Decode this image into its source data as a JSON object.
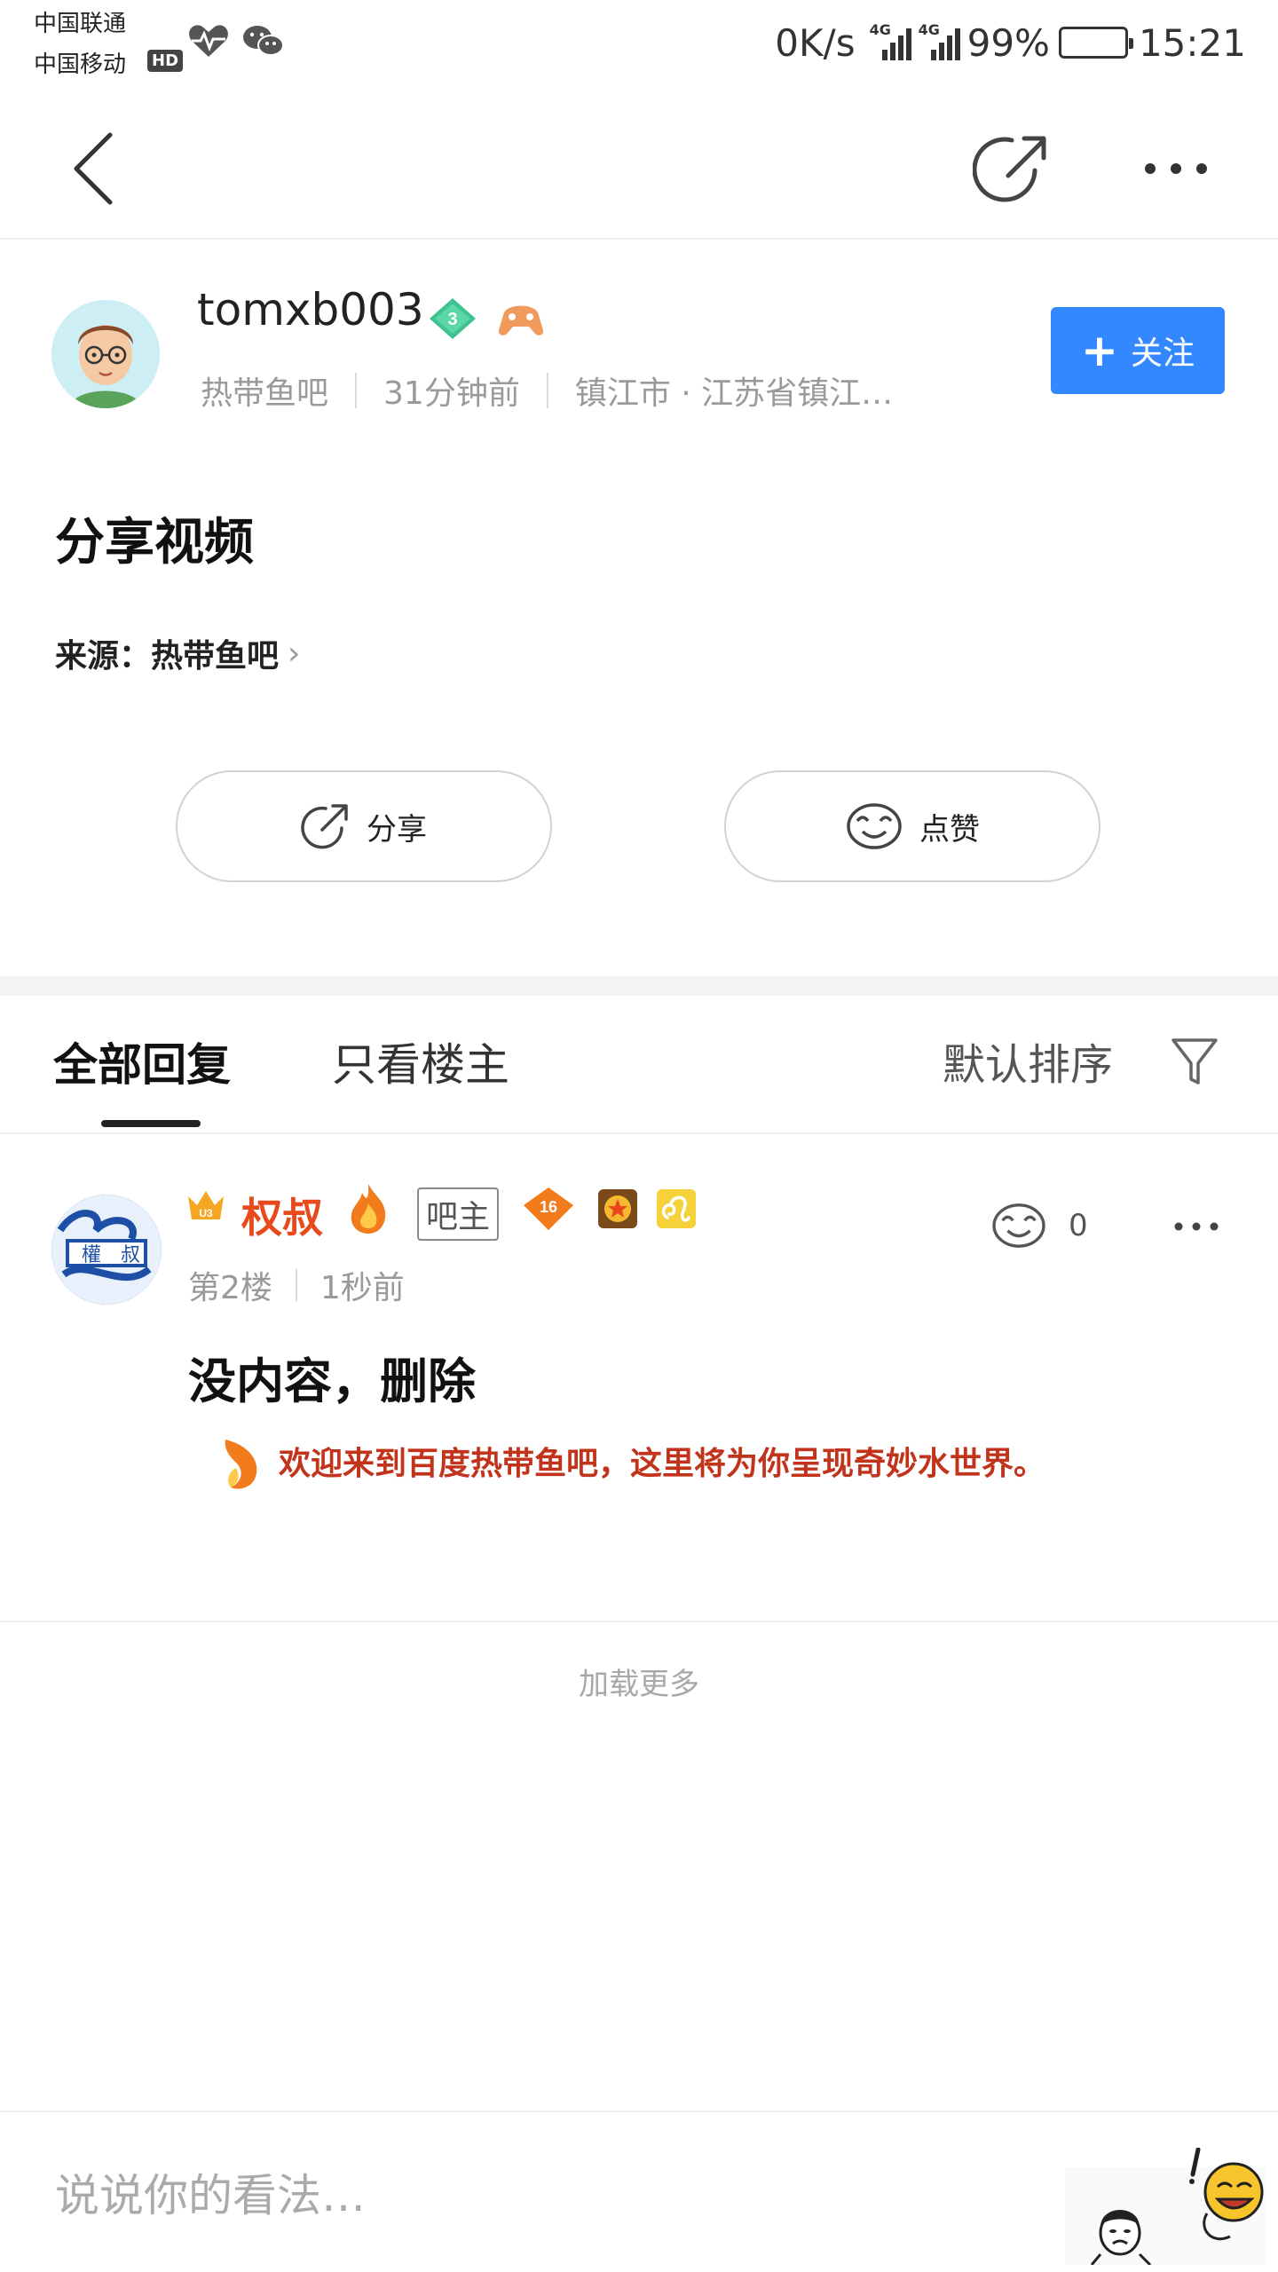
{
  "status_bar": {
    "carrier1": "中国联通",
    "carrier2": "中国移动",
    "hd_label": "HD",
    "net_speed": "0K/s",
    "network_type": "4G",
    "battery": "99%",
    "time": "15:21"
  },
  "nav": {
    "back_icon": "chevron-left-icon",
    "share_icon": "share-arrow-icon",
    "more_icon": "more-dots-icon"
  },
  "author": {
    "name": "tomxb003",
    "level": "3",
    "forum": "热带鱼吧",
    "time_ago": "31分钟前",
    "location": "镇江市 · 江苏省镇江…",
    "follow_label": "关注",
    "follow_color": "#3388ff"
  },
  "post": {
    "title": "分享视频",
    "source_label": "来源：热带鱼吧",
    "source_chevron": "›",
    "share_label": "分享",
    "like_label": "点赞"
  },
  "tabs": {
    "all_label": "全部回复",
    "host_only_label": "只看楼主",
    "sort_label": "默认排序"
  },
  "reply": {
    "username": "权叔",
    "name_color": "#e84a1e",
    "role": "吧主",
    "level": "16",
    "floor": "第2楼",
    "time_ago": "1秒前",
    "like_count": "0",
    "text": "没内容，删除",
    "signature": "欢迎来到百度热带鱼吧，这里将为你呈现奇妙水世界。",
    "signature_color": "#c2331b"
  },
  "load_more": "加载更多",
  "comment_bar": {
    "placeholder": "说说你的看法…"
  }
}
